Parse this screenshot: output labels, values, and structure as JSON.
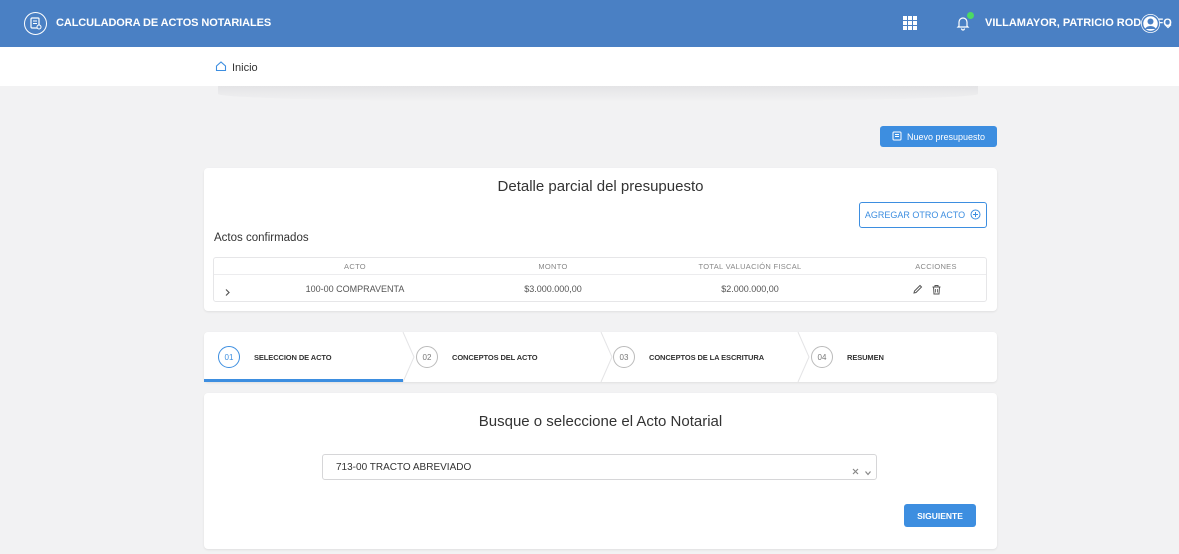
{
  "header": {
    "app_title": "CALCULADORA DE ACTOS NOTARIALES",
    "user_name": "VILLAMAYOR, PATRICIO RODOLFO",
    "notification_dot_color": "#4cd964",
    "brand_color": "#4a80c4"
  },
  "breadcrumb": {
    "home_label": "Inicio"
  },
  "actions": {
    "new_budget_label": "Nuevo presupuesto"
  },
  "detail": {
    "title": "Detalle parcial del presupuesto",
    "add_act_label": "AGREGAR OTRO ACTO",
    "confirmed_title": "Actos confirmados",
    "columns": [
      "ACTO",
      "MONTO",
      "TOTAL VALUACIÓN FISCAL",
      "ACCIONES"
    ],
    "rows": [
      {
        "acto": "100-00 COMPRAVENTA",
        "monto": "$3.000.000,00",
        "valuacion": "$2.000.000,00"
      }
    ]
  },
  "stepper": {
    "steps": [
      {
        "num": "01",
        "label": "SELECCION DE ACTO"
      },
      {
        "num": "02",
        "label": "CONCEPTOS DEL ACTO"
      },
      {
        "num": "03",
        "label": "CONCEPTOS DE LA ESCRITURA"
      },
      {
        "num": "04",
        "label": "RESUMEN"
      }
    ],
    "active_index": 0
  },
  "select_section": {
    "title": "Busque o seleccione el Acto Notarial",
    "selected_value": "713-00 TRACTO ABREVIADO",
    "next_label": "SIGUIENTE"
  },
  "accent_color": "#3d8ee0"
}
